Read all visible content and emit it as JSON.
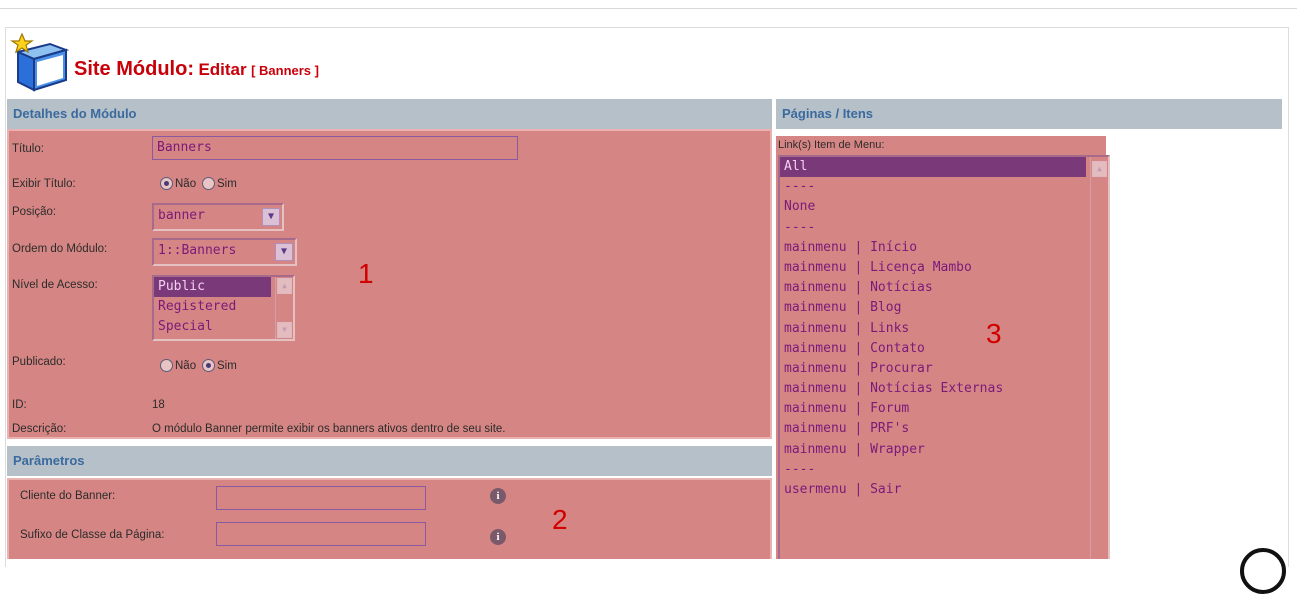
{
  "header": {
    "title_part1": "Site Módulo:",
    "title_part2": "Editar",
    "title_part3": "[ Banners ]"
  },
  "details": {
    "heading": "Detalhes do Módulo",
    "titulo_label": "Título:",
    "titulo_value": "Banners",
    "exibir_label": "Exibir Título:",
    "exibir_options": [
      "Não",
      "Sim"
    ],
    "exibir_selected": "Não",
    "posicao_label": "Posição:",
    "posicao_value": "banner",
    "ordem_label": "Ordem do Módulo:",
    "ordem_value": "1::Banners",
    "nivel_label": "Nível de Acesso:",
    "nivel_options": [
      "Public",
      "Registered",
      "Special"
    ],
    "nivel_selected": "Public",
    "publicado_label": "Publicado:",
    "publicado_options": [
      "Não",
      "Sim"
    ],
    "publicado_selected": "Sim",
    "id_label": "ID:",
    "id_value": "18",
    "descricao_label": "Descrição:",
    "descricao_value": "O módulo Banner permite exibir os banners ativos dentro de seu site."
  },
  "params": {
    "heading": "Parâmetros",
    "cliente_label": "Cliente do Banner:",
    "cliente_value": "",
    "sufixo_label": "Sufixo de Classe da Página:",
    "sufixo_value": ""
  },
  "pages": {
    "heading": "Páginas / Itens",
    "links_label": "Link(s) Item de Menu:",
    "items": [
      "All",
      "----",
      "None",
      "----",
      "mainmenu | Início",
      "mainmenu | Licença Mambo",
      "mainmenu | Notícias",
      "mainmenu | Blog",
      "mainmenu | Links",
      "mainmenu | Contato",
      "mainmenu | Procurar",
      "mainmenu | Notícias Externas",
      "mainmenu | Forum",
      "mainmenu | PRF's",
      "mainmenu | Wrapper",
      "----",
      "usermenu | Sair"
    ],
    "selected": "All"
  },
  "annotations": {
    "one": "1",
    "two": "2",
    "three": "3"
  },
  "colors": {
    "accent_red": "#c8000a",
    "section_bar": "#b6c0c8",
    "highlight_pink": "#d58684"
  }
}
